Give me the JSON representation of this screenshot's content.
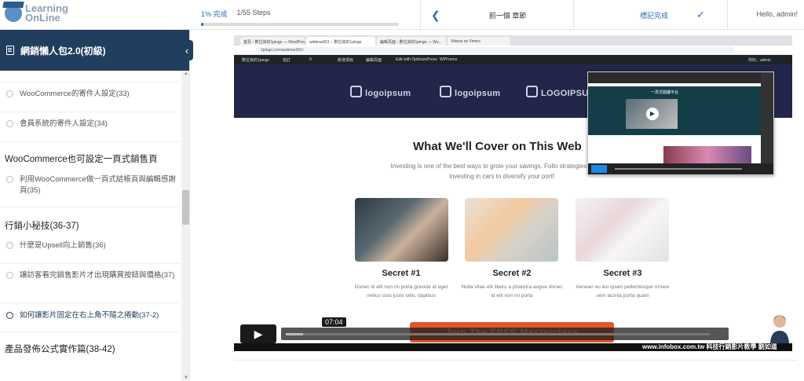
{
  "brand": {
    "line1": "Learning",
    "line2": "OnLine"
  },
  "progress": {
    "percent_label": "1% 完成",
    "steps_label": "1/55 Steps",
    "fraction": 0.01
  },
  "nav": {
    "prev_label": "前一個 章節",
    "complete_label": "標記完成",
    "greeting": "Hello, admin!"
  },
  "sidebar": {
    "course_title": "網銷懶人包2.0(初級)",
    "lessons": [
      {
        "label": "WooCommerce的寄件人設定(33)"
      },
      {
        "label": "會員系統的寄件人設定(34)"
      },
      {
        "label": "利用WooCommerce做一頁式結帳頁與編輯感謝頁(35)"
      },
      {
        "label": "什麼是Upsell向上銷售(36)"
      },
      {
        "label": "讓訪客看完銷售影片才出現購買按鈕與價格(37)"
      },
      {
        "label": "如何讓影片固定在右上角不隨之捲動(37-2)"
      }
    ],
    "sections": [
      {
        "title": "WooCommerce也可設定一頁式銷售頁"
      },
      {
        "title": "行銷小秘技(36-37)"
      },
      {
        "title": "產品發佈公式實作篇(38-42)"
      }
    ]
  },
  "video": {
    "browser_tabs": [
      "首頁 ‹ 數位資的1pingo — WordPress",
      "webinar001 – 數位資的1pingo",
      "編輯頁面 ‹ 數位資的1pingo — Wo...",
      "Videos on Vimeo"
    ],
    "url": "1pingo.com/webinar001/",
    "wp_bar": [
      "數位資的1pingo",
      "自訂",
      "0",
      "新增項目",
      "編輯頁面",
      "Edit with OptimizePress",
      "WPForms",
      "你好，admin"
    ],
    "logos": [
      "logoipsum",
      "logoipsum",
      "LOGOIPSUM"
    ],
    "cover_title": "What We'll Cover on This Web",
    "cover_text": "Investing is one of the best ways to grow your savings. Follo strategies and start investing in cars to diversify your portf",
    "cards": [
      {
        "title": "Secret #1",
        "text": "Donec id elit non mi porta gravida at eget metus cras justo odio, dapibus"
      },
      {
        "title": "Secret #2",
        "text": "Nulla vitae elit libero a pharetra augue donec id elit non mi porta"
      },
      {
        "title": "Secret #3",
        "text": "Aenean eu leo quam pellentesque ornare sem lacinia porta quam"
      }
    ],
    "cta": "Join The FREE Masterclass",
    "mini_heading": "一頁式開課平台",
    "current_time": "07:04",
    "played_fraction": 0.04,
    "watermark": "www.infobox.com.tw 科技行銷影片教學 劉如道"
  },
  "colors": {
    "sidebar_header": "#223e5e",
    "accent": "#2a6db5",
    "cta": "#e2562c",
    "hero": "#22264a"
  }
}
